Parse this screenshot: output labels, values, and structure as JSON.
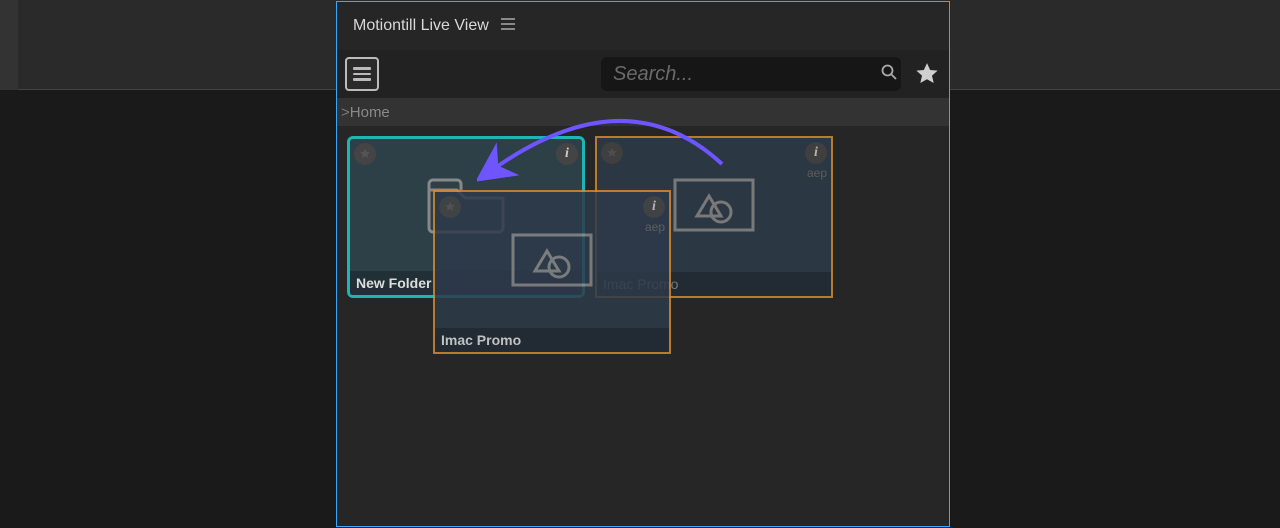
{
  "panel": {
    "title": "Motiontill Live View"
  },
  "search": {
    "placeholder": "Search..."
  },
  "breadcrumb": {
    "prefix": "> ",
    "home": "Home"
  },
  "tiles": {
    "folder": {
      "label": "New Folder"
    },
    "file": {
      "label": "Imac Promo",
      "ext": "aep"
    },
    "dragging": {
      "label": "Imac Promo",
      "ext": "aep"
    }
  },
  "icons": {
    "info_char": "i"
  }
}
